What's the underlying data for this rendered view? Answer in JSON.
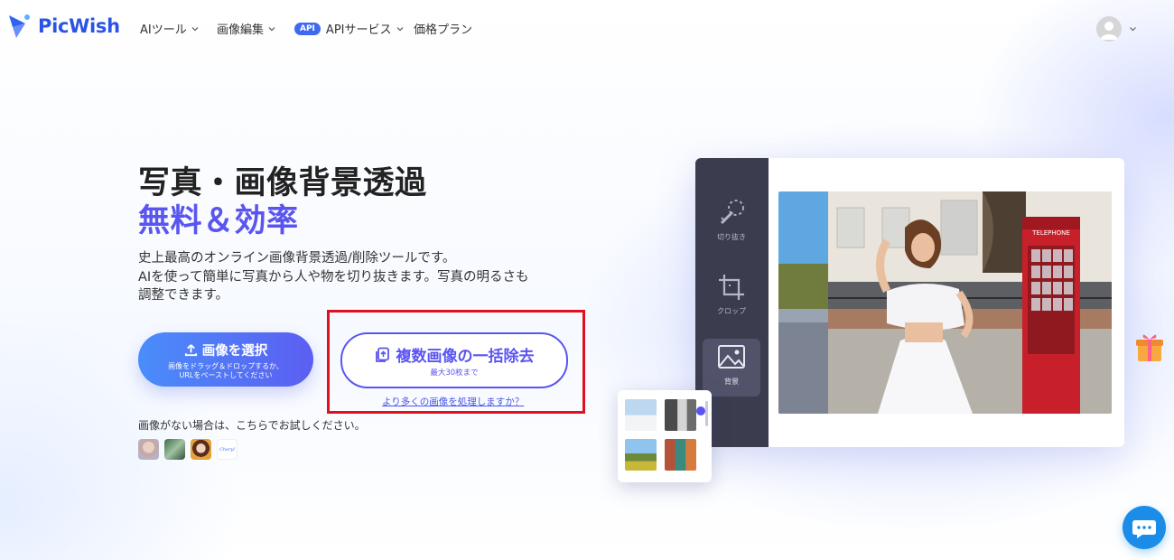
{
  "header": {
    "brand": "PicWish",
    "nav": [
      {
        "label": "AIツール",
        "has_dropdown": true
      },
      {
        "label": "画像編集",
        "has_dropdown": true
      },
      {
        "label": "APIサービス",
        "badge": "API",
        "has_dropdown": true
      },
      {
        "label": "価格プラン",
        "has_dropdown": false
      }
    ]
  },
  "hero": {
    "title_line1": "写真・画像背景透過",
    "title_line2": "無料＆効率",
    "description": [
      "史上最高のオンライン画像背景透過/削除ツールです。",
      "AIを使って簡単に写真から人や物を切り抜きます。写真の明るさも",
      "調整できます。"
    ],
    "upload_button": {
      "label": "画像を選択",
      "sub_line1": "画像をドラッグ＆ドロップするか、",
      "sub_line2": "URLをペーストしてください"
    },
    "batch_button": {
      "label": "複数画像の一括除去",
      "sub": "最大30枚まで"
    },
    "more_link": "より多くの画像を処理しますか？",
    "trial_text": "画像がない場合は、こちらでお試しください。",
    "sample_thumb_text": "Cheryl"
  },
  "editor": {
    "tools": [
      {
        "label": "切り抜き",
        "icon": "cutout-icon"
      },
      {
        "label": "クロップ",
        "icon": "crop-icon"
      },
      {
        "label": "背景",
        "icon": "image-icon"
      }
    ],
    "active_tool": "背景",
    "phone_booth_sign": "TELEPHONE"
  },
  "colors": {
    "brand_blue": "#2b53e6",
    "accent_purple": "#5a55f0",
    "editor_sidebar": "#3b3c4e",
    "highlight_red": "#e01020",
    "chat_blue": "#1b8de8"
  }
}
